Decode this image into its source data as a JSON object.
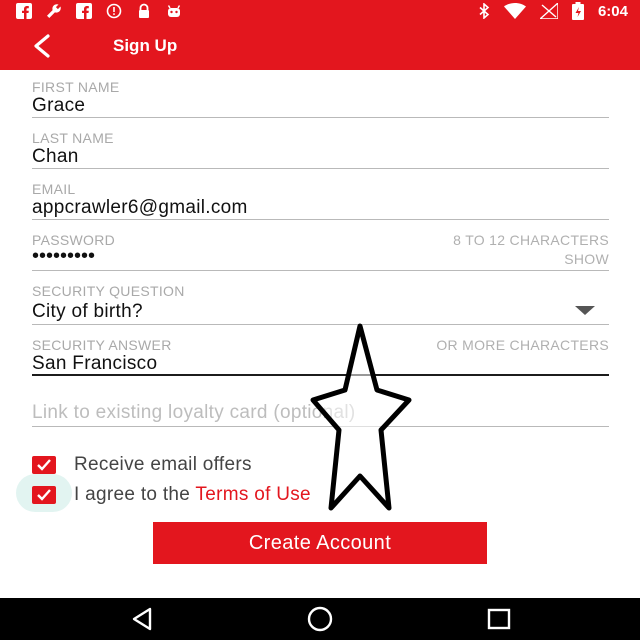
{
  "status_bar": {
    "time": "6:04",
    "left_icons": [
      "facebook-icon",
      "wrench-icon",
      "facebook-icon",
      "alert-icon",
      "lock-icon",
      "android-icon"
    ],
    "right_icons": [
      "bluetooth-icon",
      "wifi-icon",
      "signal-icon",
      "battery-icon"
    ]
  },
  "header": {
    "title": "Sign Up",
    "back_icon": "back-arrow-icon"
  },
  "form": {
    "first_name": {
      "label": "FIRST NAME",
      "value": "Grace"
    },
    "last_name": {
      "label": "LAST NAME",
      "value": "Chan"
    },
    "email": {
      "label": "EMAIL",
      "value": "appcrawler6@gmail.com"
    },
    "password": {
      "label": "PASSWORD",
      "hint": "8 TO 12 CHARACTERS",
      "value": "•••••••••",
      "show_label": "SHOW"
    },
    "security_question": {
      "label": "SECURITY QUESTION",
      "value": "City of birth?"
    },
    "security_answer": {
      "label": "SECURITY ANSWER",
      "hint": "OR MORE CHARACTERS",
      "value": "San Francisco"
    },
    "loyalty": {
      "placeholder": "Link to existing loyalty card (optional)"
    },
    "email_offers": {
      "label": "Receive email offers",
      "checked": true
    },
    "agree": {
      "prefix": "I agree to the ",
      "link": "Terms of Use",
      "checked": true
    },
    "submit_label": "Create Account"
  },
  "colors": {
    "primary": "#e3161e",
    "nav_bar": "#000000"
  },
  "nav_bar": {
    "icons": [
      "back-triangle-icon",
      "home-circle-icon",
      "recents-square-icon"
    ]
  }
}
